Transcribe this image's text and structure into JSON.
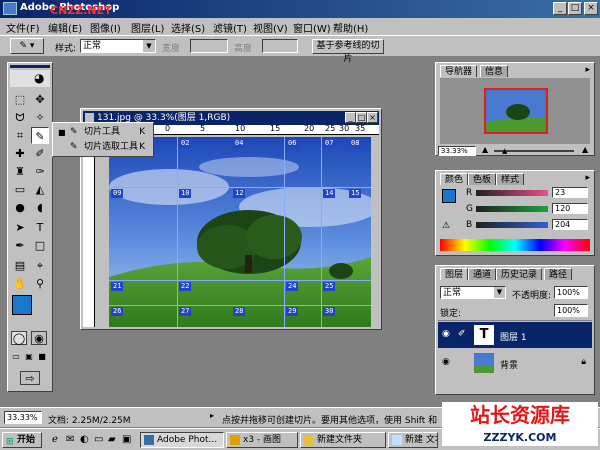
{
  "window": {
    "title": "Adobe Photoshop",
    "watermark": "CNZZ.NET"
  },
  "menubar": {
    "items": [
      "文件(F)",
      "编辑(E)",
      "图像(I)",
      "图层(L)",
      "选择(S)",
      "滤镜(T)",
      "视图(V)",
      "窗口(W)",
      "帮助(H)"
    ]
  },
  "options": {
    "style_label": "样式:",
    "style_value": "正常",
    "width_label": "宽度",
    "height_label": "高度",
    "guides_button": "基于参考线的切片"
  },
  "flyout": {
    "items": [
      "切片工具",
      "切片选取工具"
    ],
    "shortcut": "K"
  },
  "document": {
    "title": "131.jpg @ 33.3%(图层 1,RGB)",
    "ruler_ticks": [
      "0",
      "5",
      "10",
      "15",
      "20",
      "25",
      "30",
      "35"
    ],
    "slices": [
      {
        "label": "02"
      },
      {
        "label": "04"
      },
      {
        "label": "06"
      },
      {
        "label": "07"
      },
      {
        "label": "08"
      },
      {
        "label": "09"
      },
      {
        "label": "10"
      },
      {
        "label": "12"
      },
      {
        "label": "14"
      },
      {
        "label": "15"
      },
      {
        "label": "21"
      },
      {
        "label": "22"
      },
      {
        "label": "24"
      },
      {
        "label": "25"
      },
      {
        "label": "26"
      },
      {
        "label": "27"
      },
      {
        "label": "28"
      },
      {
        "label": "29"
      },
      {
        "label": "30"
      }
    ]
  },
  "navigator": {
    "tabs": [
      "导航器",
      "信息"
    ],
    "zoom": "33.33%"
  },
  "color_panel": {
    "tabs": [
      "颜色",
      "色板",
      "样式"
    ],
    "channels": [
      {
        "name": "R",
        "value": "23",
        "color": "#e8508c"
      },
      {
        "name": "G",
        "value": "120",
        "color": "#20a040"
      },
      {
        "name": "B",
        "value": "204",
        "color": "#3060d0"
      }
    ],
    "foreground": "#1778cc"
  },
  "layers_panel": {
    "tabs": [
      "图层",
      "通道",
      "历史记录",
      "路径"
    ],
    "blend_mode": "正常",
    "opacity_label": "不透明度:",
    "opacity_value": "100%",
    "fill_value": "100%",
    "lock_label": "锁定:",
    "layers": [
      {
        "name": "图层 1",
        "thumb": "T",
        "selected": true
      },
      {
        "name": "背景",
        "thumb": "",
        "selected": false
      }
    ]
  },
  "status": {
    "zoom": "33.33%",
    "doc_size": "文档: 2.25M/2.25M",
    "hint": "点按并拖移可创建切片。要用其他选项，使用 Shift 和"
  },
  "taskbar": {
    "start": "开始",
    "buttons": [
      "Adobe Phot...",
      "x3 - 画图",
      "新建文件夹",
      "新建 文本"
    ]
  },
  "branding": {
    "name": "站长资源库",
    "url": "ZZZYK.COM"
  },
  "colors": {
    "titlebar": "#0a246a",
    "panel": "#c0c0c0",
    "workspace": "#808080",
    "slice_badge": "#2244cc"
  }
}
